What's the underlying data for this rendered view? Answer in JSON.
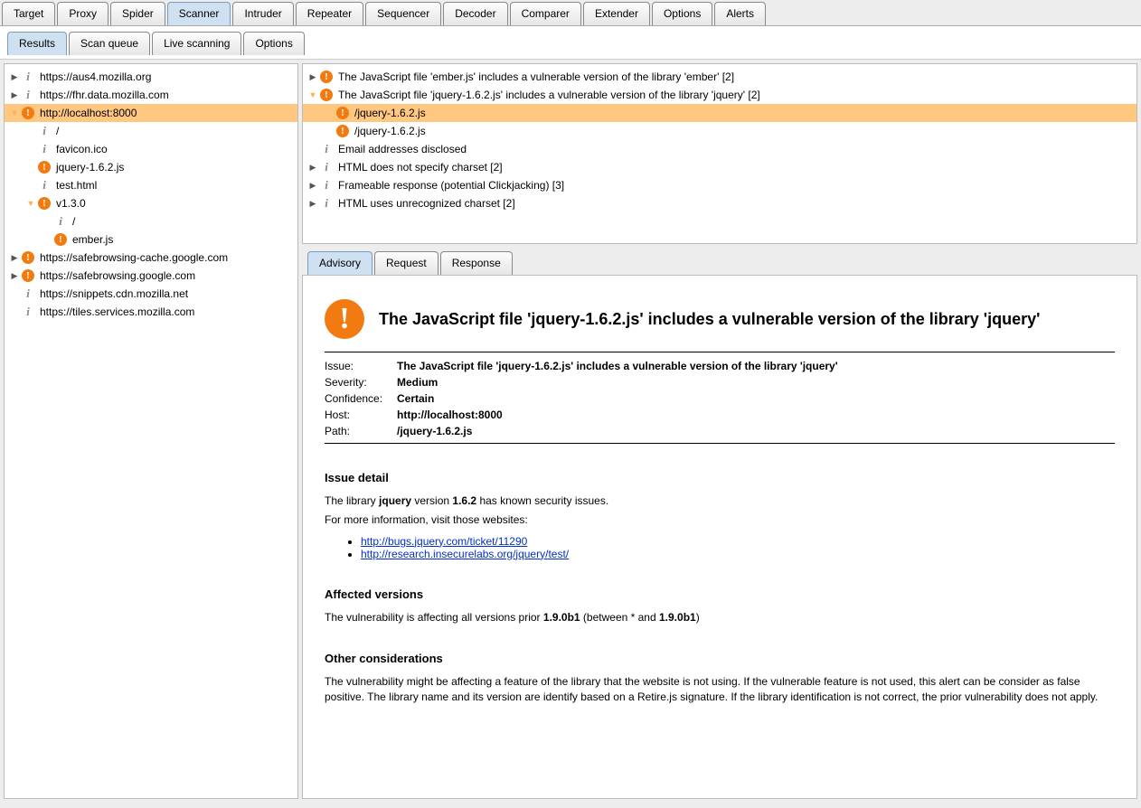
{
  "mainTabs": [
    "Target",
    "Proxy",
    "Spider",
    "Scanner",
    "Intruder",
    "Repeater",
    "Sequencer",
    "Decoder",
    "Comparer",
    "Extender",
    "Options",
    "Alerts"
  ],
  "mainActive": 3,
  "subTabs": [
    "Results",
    "Scan queue",
    "Live scanning",
    "Options"
  ],
  "subActive": 0,
  "leftTree": [
    {
      "d": 0,
      "a": "▶",
      "i": "info",
      "t": "https://aus4.mozilla.org"
    },
    {
      "d": 0,
      "a": "▶",
      "i": "info",
      "t": "https://fhr.data.mozilla.com"
    },
    {
      "d": 0,
      "a": "▼",
      "i": "bang",
      "t": "http://localhost:8000",
      "sel": true,
      "open": true
    },
    {
      "d": 1,
      "a": "",
      "i": "info",
      "t": "/"
    },
    {
      "d": 1,
      "a": "",
      "i": "info",
      "t": "favicon.ico"
    },
    {
      "d": 1,
      "a": "",
      "i": "bang",
      "t": "jquery-1.6.2.js"
    },
    {
      "d": 1,
      "a": "",
      "i": "info",
      "t": "test.html"
    },
    {
      "d": 1,
      "a": "▼",
      "i": "bang",
      "t": "v1.3.0",
      "open": true
    },
    {
      "d": 2,
      "a": "",
      "i": "info",
      "t": "/"
    },
    {
      "d": 2,
      "a": "",
      "i": "bang",
      "t": "ember.js"
    },
    {
      "d": 0,
      "a": "▶",
      "i": "bang",
      "t": "https://safebrowsing-cache.google.com"
    },
    {
      "d": 0,
      "a": "▶",
      "i": "bang",
      "t": "https://safebrowsing.google.com"
    },
    {
      "d": 0,
      "a": "",
      "i": "info",
      "t": "https://snippets.cdn.mozilla.net"
    },
    {
      "d": 0,
      "a": "",
      "i": "info",
      "t": "https://tiles.services.mozilla.com"
    }
  ],
  "issues": [
    {
      "d": 0,
      "a": "▶",
      "i": "bang",
      "t": "The JavaScript file 'ember.js' includes a vulnerable version of the library 'ember' [2]"
    },
    {
      "d": 0,
      "a": "▼",
      "i": "bang",
      "t": "The JavaScript file 'jquery-1.6.2.js' includes a vulnerable version of the library 'jquery' [2]",
      "open": true
    },
    {
      "d": 1,
      "a": "",
      "i": "bang",
      "t": "/jquery-1.6.2.js",
      "sel": true
    },
    {
      "d": 1,
      "a": "",
      "i": "bang",
      "t": "/jquery-1.6.2.js"
    },
    {
      "d": 0,
      "a": "",
      "i": "info",
      "t": "Email addresses disclosed"
    },
    {
      "d": 0,
      "a": "▶",
      "i": "info",
      "t": "HTML does not specify charset [2]"
    },
    {
      "d": 0,
      "a": "▶",
      "i": "info",
      "t": "Frameable response (potential Clickjacking) [3]"
    },
    {
      "d": 0,
      "a": "▶",
      "i": "info",
      "t": "HTML uses unrecognized charset [2]"
    }
  ],
  "detailsTabs": [
    "Advisory",
    "Request",
    "Response"
  ],
  "detailsActive": 0,
  "advisory": {
    "title": "The JavaScript file 'jquery-1.6.2.js' includes a vulnerable version of the library 'jquery'",
    "issue": "The JavaScript file 'jquery-1.6.2.js' includes a vulnerable version of the library 'jquery'",
    "severity": "Medium",
    "confidence": "Certain",
    "host": "http://localhost:8000",
    "path": "/jquery-1.6.2.js",
    "labels": {
      "issue": "Issue:",
      "severity": "Severity:",
      "confidence": "Confidence:",
      "host": "Host:",
      "path": "Path:"
    },
    "detailHeading": "Issue detail",
    "detailPrefix": "The library ",
    "detailLib": "jquery",
    "detailMid": " version ",
    "detailVer": "1.6.2",
    "detailSuffix": " has known security issues.",
    "detailMore": "For more information, visit those websites:",
    "links": [
      "http://bugs.jquery.com/ticket/11290",
      "http://research.insecurelabs.org/jquery/test/"
    ],
    "affectedHeading": "Affected versions",
    "affectedPrefix": "The vulnerability is affecting all versions prior ",
    "affectedV1": "1.9.0b1",
    "affectedMid": " (between * and ",
    "affectedV2": "1.9.0b1",
    "affectedSuffix": ")",
    "otherHeading": "Other considerations",
    "otherText": "The vulnerability might be affecting a feature of the library that the website is not using. If the vulnerable feature is not used, this alert can be consider as false positive. The library name and its version are identify based on a Retire.js signature. If the library identification is not correct, the prior vulnerability does not apply."
  }
}
